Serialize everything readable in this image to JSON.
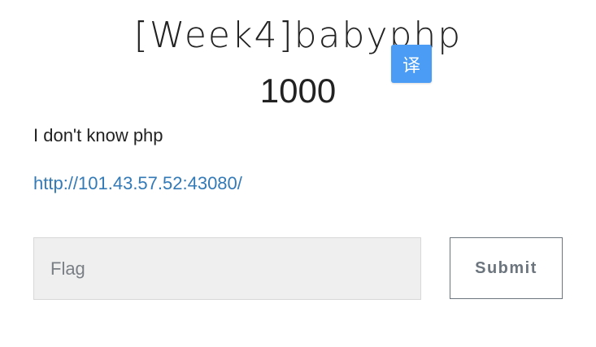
{
  "challenge": {
    "title": "[Week4]babyphp",
    "value": "1000",
    "description": "I don't know php",
    "link_text": "http://101.43.57.52:43080/"
  },
  "translate": {
    "label": "译"
  },
  "form": {
    "flag_placeholder": "Flag",
    "submit_label": "Submit"
  }
}
